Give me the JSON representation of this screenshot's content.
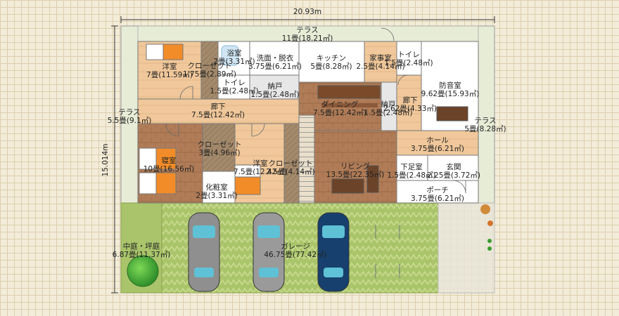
{
  "dimensions": {
    "width": "20.93m",
    "height": "15.014m"
  },
  "rooms": [
    {
      "id": "terrace-top",
      "name": "テラス",
      "area": "11畳(18.21㎡)"
    },
    {
      "id": "bath",
      "name": "浴室",
      "area": "2畳(3.31㎡)"
    },
    {
      "id": "western1",
      "name": "洋室",
      "area": "7畳(11.59㎡)"
    },
    {
      "id": "closet1",
      "name": "クローゼット",
      "area": "1.75畳(2.89㎡)"
    },
    {
      "id": "washroom",
      "name": "洗面・脱衣",
      "area": "3.75畳(6.21㎡)"
    },
    {
      "id": "kitchen",
      "name": "キッチン",
      "area": "5畳(8.28㎡)"
    },
    {
      "id": "utility",
      "name": "家事室",
      "area": "2.5畳(4.14㎡)"
    },
    {
      "id": "toilet-east",
      "name": "トイレ",
      "area": "1.5畳(2.48㎡)"
    },
    {
      "id": "toilet-west",
      "name": "トイレ",
      "area": "1.5畳(2.48㎡)"
    },
    {
      "id": "storage1",
      "name": "納戸",
      "area": "1.5畳(2.48㎡)"
    },
    {
      "id": "soundproof",
      "name": "防音室",
      "area": "9.62畳(15.93㎡)"
    },
    {
      "id": "corridor1",
      "name": "廊下",
      "area": "7.5畳(12.42㎡)"
    },
    {
      "id": "dining",
      "name": "ダイニング",
      "area": "7.5畳(12.42㎡)"
    },
    {
      "id": "storage2",
      "name": "納戸",
      "area": "1.5畳(2.48㎡)"
    },
    {
      "id": "corridor2",
      "name": "廊下",
      "area": "2.62畳(4.33㎡)"
    },
    {
      "id": "terrace-west",
      "name": "テラス",
      "area": "5.5畳(9.1㎡)"
    },
    {
      "id": "terrace-east",
      "name": "テラス",
      "area": "5畳(8.28㎡)"
    },
    {
      "id": "closet2",
      "name": "クローゼット",
      "area": "3畳(4.96㎡)"
    },
    {
      "id": "hall",
      "name": "ホール",
      "area": "3.75畳(6.21㎡)"
    },
    {
      "id": "bedroom",
      "name": "寝室",
      "area": "10畳(16.56㎡)"
    },
    {
      "id": "western2",
      "name": "洋室",
      "area": "7.5畳(12.42㎡)"
    },
    {
      "id": "closet3",
      "name": "クローゼット",
      "area": "2.5畳(4.14㎡)"
    },
    {
      "id": "living",
      "name": "リビング",
      "area": "13.5畳(22.35㎡)"
    },
    {
      "id": "shoe-room",
      "name": "下足室",
      "area": "1.5畳(2.48㎡)"
    },
    {
      "id": "entrance",
      "name": "玄関",
      "area": "2.25畳(3.72㎡)"
    },
    {
      "id": "dresser",
      "name": "化粧室",
      "area": "2畳(3.31㎡)"
    },
    {
      "id": "porch",
      "name": "ポーチ",
      "area": "3.75畳(6.21㎡)"
    },
    {
      "id": "courtyard",
      "name": "中庭・坪庭",
      "area": "6.87畳(11.37㎡)"
    },
    {
      "id": "garage",
      "name": "ガレージ",
      "area": "46.75畳(77.42㎡)"
    }
  ],
  "cars": [
    {
      "id": "car1",
      "color": "#8f8f8f"
    },
    {
      "id": "car2",
      "color": "#9a9a9a"
    },
    {
      "id": "car3",
      "color": "#17406e"
    }
  ]
}
